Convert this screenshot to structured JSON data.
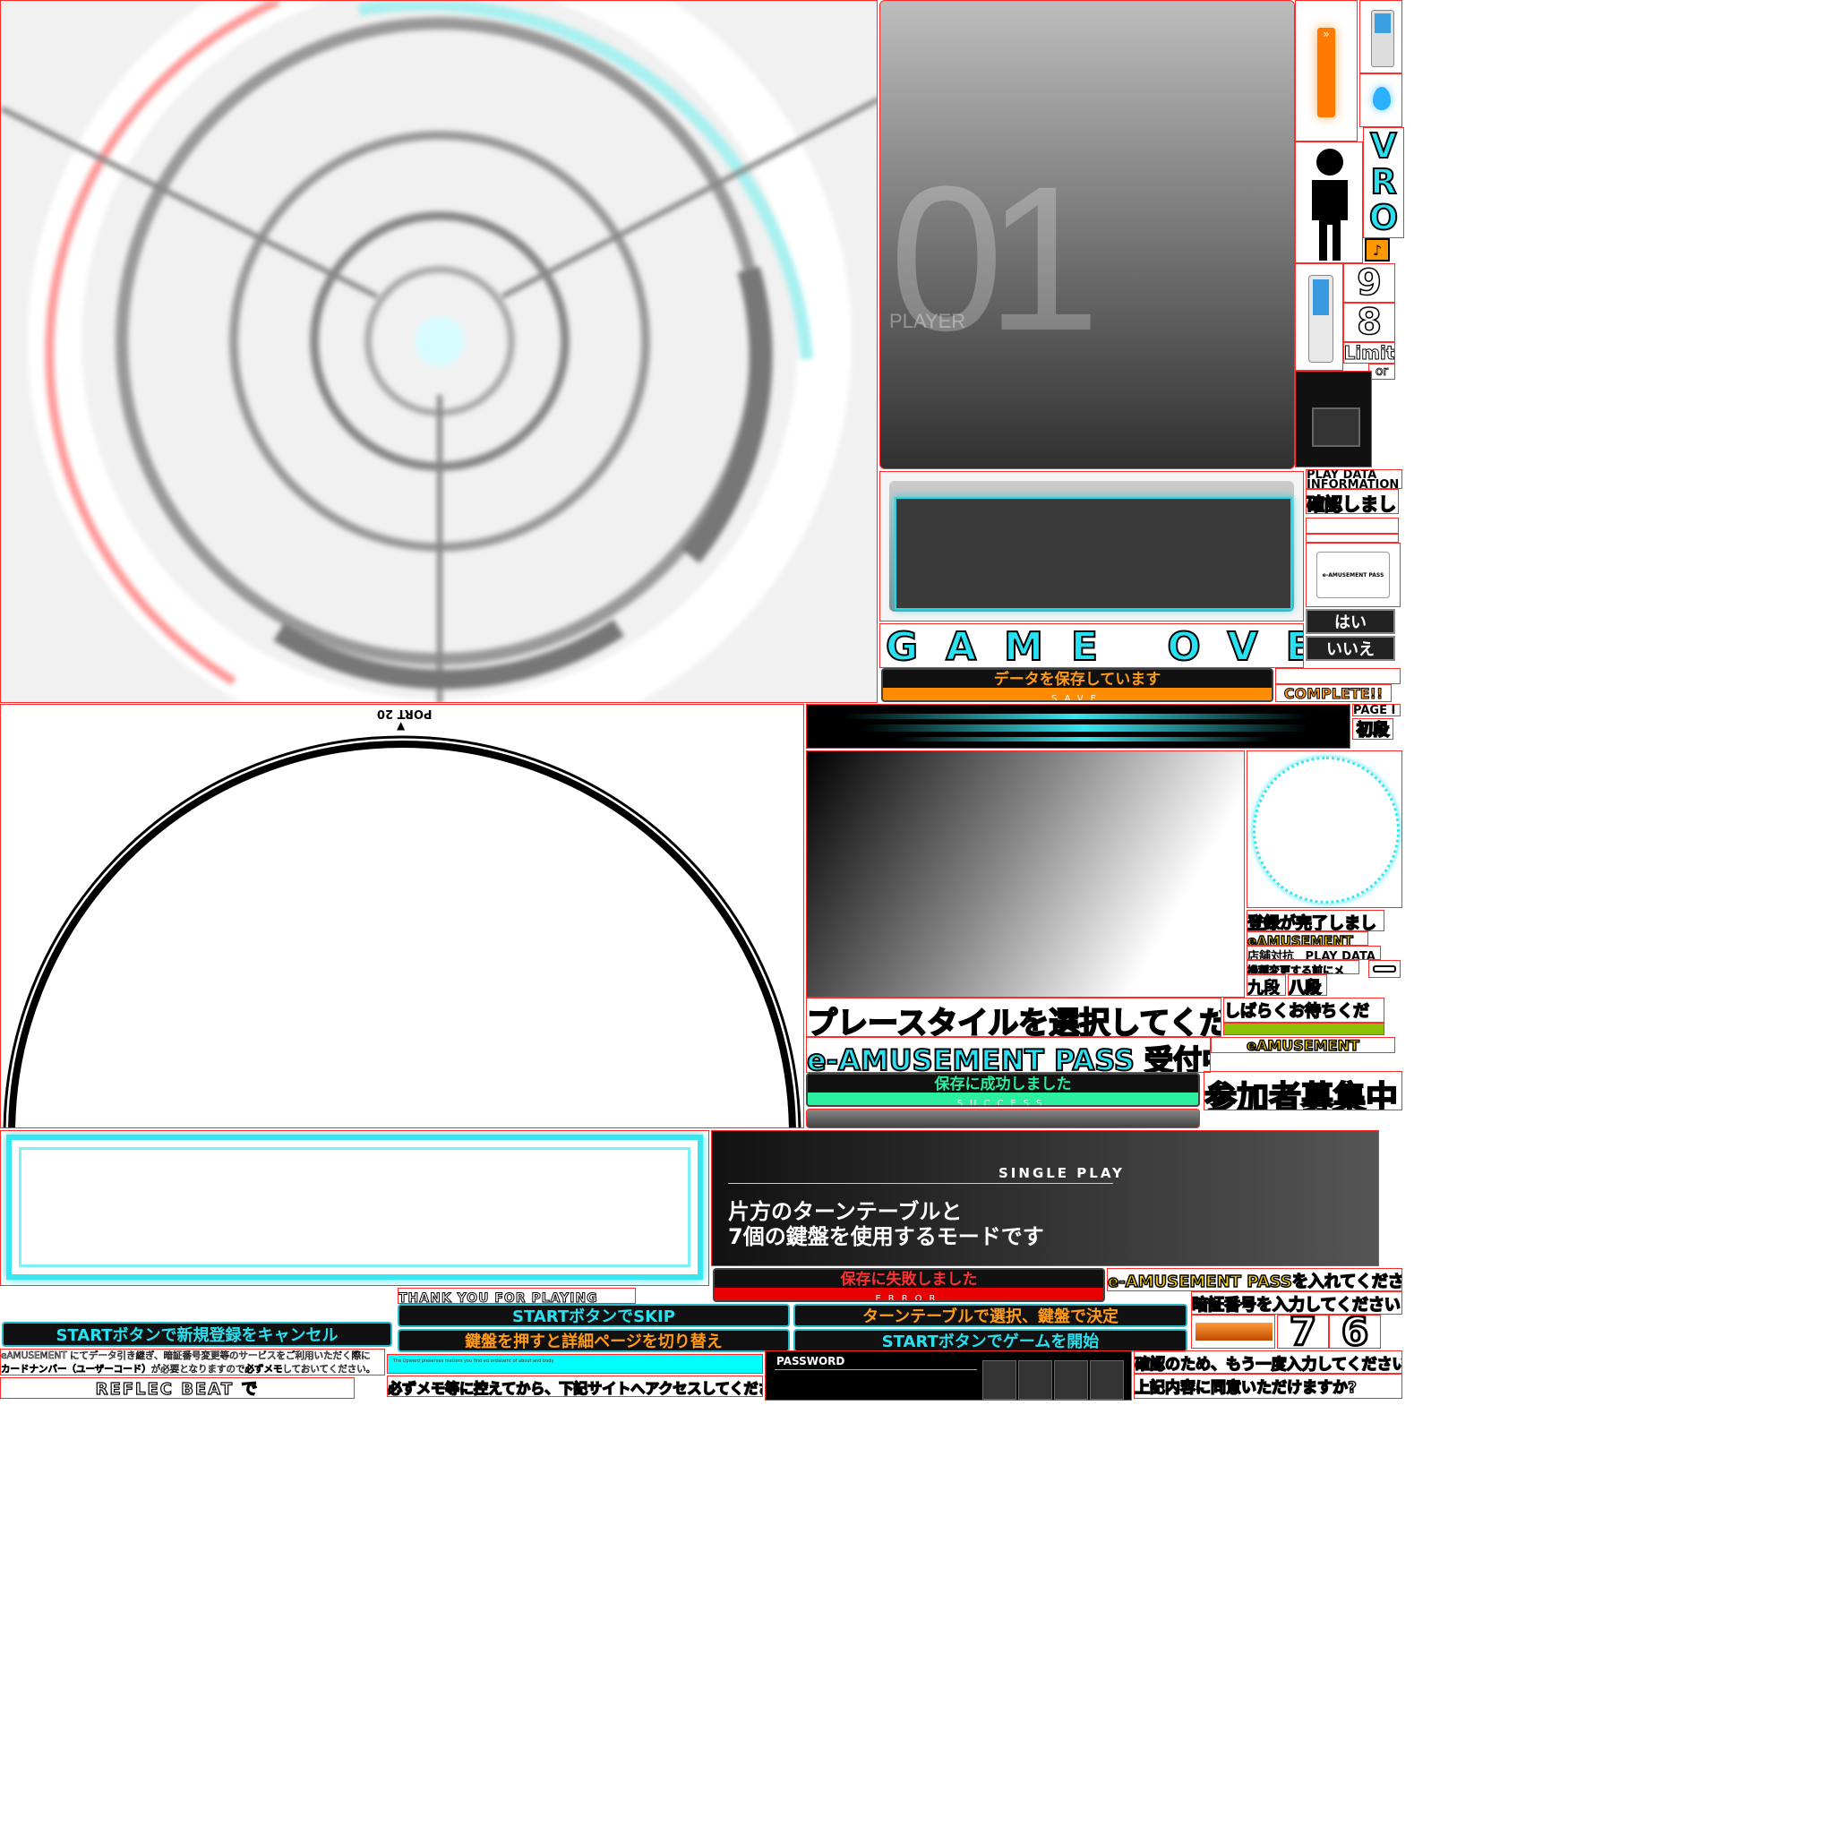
{
  "player_panel": {
    "number": "01",
    "label": "PLAYER"
  },
  "turntable": {
    "port_label": "PORT 20"
  },
  "sidebar": {
    "vro": [
      "V",
      "R",
      "O"
    ],
    "digits": [
      "9",
      "8"
    ],
    "limit": "Limit",
    "or": "or"
  },
  "info": {
    "play_data": "PLAY DATA",
    "information": "INFORMATION",
    "confirmed": "確認しました",
    "pass_card": "e-AMUSEMENT PASS",
    "yes": "はい",
    "no": "いいえ"
  },
  "game_over": "GAME OVER",
  "save": {
    "saving": "データを保存しています",
    "save_sub": "SAVE",
    "complete": "COMPLETE!!",
    "success": "保存に成功しました",
    "success_sub": "SUCCESS",
    "failed": "保存に失敗しました",
    "failed_sub": "ERROR"
  },
  "rank": {
    "page": "PAGE I",
    "shodan": "初段",
    "kudan": "九段",
    "hachidan": "八段"
  },
  "registration": {
    "done": "登録が完了しました",
    "eamusement": "eAMUSEMENT",
    "store_play": "店舗対抗",
    "play_data": "PLAY DATA",
    "memo_before_change": "機種変更する前にメモ!",
    "please_wait": "しばらくお待ちください",
    "eamusement2": "eAMUSEMENT"
  },
  "messages": {
    "select_style": "プレースタイルを選択してください",
    "pass_accepting": "e-AMUSEMENT PASS 受付中",
    "recruiting": "参加者募集中",
    "insert_pass_brand": "e-AMUSEMENT PASS",
    "insert_pass_rest": "を入れてください",
    "pin_brand": "暗証番号",
    "pin_rest": "を入力してください",
    "confirm_prefix": "確認のため、",
    "confirm_highlight": "もう一度入力",
    "confirm_rest": "してください",
    "agree": "上記内容に同意いただけますか?"
  },
  "single_play": {
    "title": "SINGLE PLAY",
    "line1": "片方のターンテーブルと",
    "line2": "7個の鍵盤を使用するモードです"
  },
  "buttons": {
    "cancel_reg": "STARTボタンで新規登録をキャンセル",
    "skip": "STARTボタンでSKIP",
    "page_switch": "鍵盤を押すと詳細ページを切り替え",
    "select_decide": "ターンテーブルで選択、鍵盤で決定",
    "start_game": "STARTボタンでゲームを開始"
  },
  "thank_you": "THANK YOU FOR PLAYING",
  "notes": {
    "line1": "eAMUSEMENT にてデータ引き継ぎ、暗証番号変更等のサービスをご利用いただく際に",
    "line2_hl": "カードナンバー（ユーザーコード）",
    "line2_mid": "が必要となりますので",
    "line2_hl2": "必ずメモ",
    "line2_end": "しておいてください。",
    "reflec": "REFLEC BEAT で",
    "memo_site": "必ずメモ等に控えてから、下記サイトへアクセスしてください",
    "tiny": "The Upward preserves matters you find ed.ordatarnt of about and body"
  },
  "password": {
    "label": "PASSWORD"
  },
  "big_digits": [
    "7",
    "6"
  ],
  "colors": {
    "cyan": "#28e0f0",
    "orange": "#ff8c00",
    "yellow": "#ffd400",
    "success_green": "#2cf0a0",
    "fail_red": "#e80000",
    "outline": "#ff2a2a"
  }
}
